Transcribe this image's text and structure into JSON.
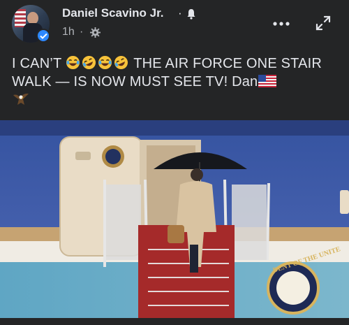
{
  "post": {
    "author": "Daniel Scavino Jr.",
    "separator": "·",
    "time": "1h",
    "meta_separator": "·",
    "privacy_icon": "gear-icon",
    "caption_start": "I CAN’T",
    "caption_middle": "THE AIR FORCE ONE STAIR WALK — IS NOW MUST SEE TV! Dan",
    "emojis": [
      "laughing-crying-face",
      "rolling-laughing-face",
      "laughing-crying-face",
      "rolling-laughing-face"
    ],
    "caption_end_icons": [
      "us-flag-icon",
      "eagle-icon"
    ]
  },
  "video": {
    "seal_text": "DENT OF THE UNITE",
    "scene": "man-with-umbrella-climbing-air-force-one-stairs"
  },
  "colors": {
    "background": "#242526",
    "text": "#e4e6eb",
    "secondary_text": "#b0b3b8",
    "verified_blue": "#2d88ff",
    "emoji_yellow": "#f7c23a"
  }
}
